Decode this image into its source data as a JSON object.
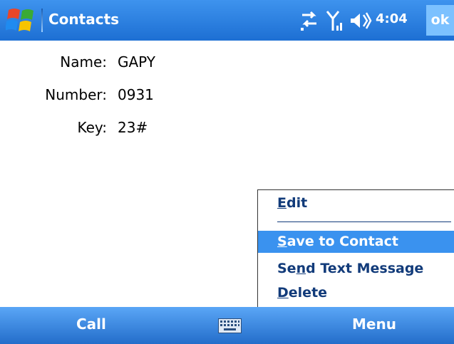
{
  "titlebar": {
    "title": "Contacts",
    "clock": "4:04",
    "ok_label": "ok",
    "icons": [
      "windows-start-icon",
      "connectivity-icon",
      "signal-strength-icon",
      "volume-icon"
    ]
  },
  "contact": {
    "name_label": "Name:",
    "name_value": "GAPY",
    "number_label": "Number:",
    "number_value": "0931",
    "key_label": "Key:",
    "key_value": "23#"
  },
  "menu": {
    "items": [
      "Edit",
      "Save to Contact",
      "Send Text Message",
      "Delete"
    ],
    "mnemonics": [
      "E",
      "S",
      "n",
      "D"
    ],
    "selected": "Save to Contact"
  },
  "softkeys": {
    "left": "Call",
    "right": "Menu",
    "center_icon": "keyboard-icon"
  },
  "colors": {
    "titlebar": "#1d6fd3",
    "selection": "#3a92ef",
    "menu_text": "#123b7a",
    "ok_button": "#7cc1ff"
  }
}
